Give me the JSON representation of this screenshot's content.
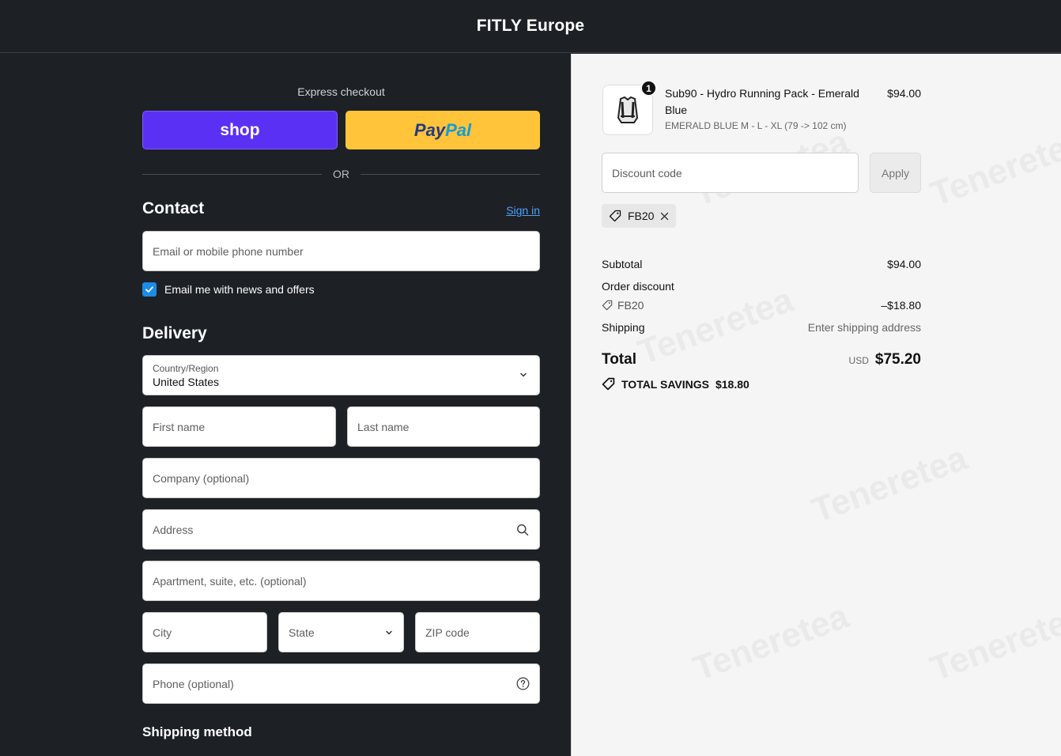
{
  "header": {
    "brand": "FITLY Europe"
  },
  "express": {
    "label": "Express checkout",
    "shop_label": "shop",
    "paypal_pay": "Pay",
    "paypal_pal": "Pal",
    "or_label": "OR"
  },
  "contact": {
    "title": "Contact",
    "sign_in": "Sign in",
    "email_placeholder": "Email or mobile phone number",
    "newsletter_label": "Email me with news and offers",
    "newsletter_checked": true
  },
  "delivery": {
    "title": "Delivery",
    "country_label": "Country/Region",
    "country_value": "United States",
    "first_name_placeholder": "First name",
    "last_name_placeholder": "Last name",
    "company_placeholder": "Company (optional)",
    "address_placeholder": "Address",
    "apartment_placeholder": "Apartment, suite, etc. (optional)",
    "city_placeholder": "City",
    "state_label": "State",
    "zip_placeholder": "ZIP code",
    "phone_placeholder": "Phone (optional)"
  },
  "shipping_method": {
    "title": "Shipping method"
  },
  "order": {
    "item": {
      "quantity": "1",
      "name": "Sub90 - Hydro Running Pack - Emerald Blue",
      "variant": "EMERALD BLUE M - L - XL (79 -> 102 cm)",
      "price": "$94.00"
    },
    "discount_placeholder": "Discount code",
    "apply_label": "Apply",
    "applied_code": "FB20",
    "subtotal_label": "Subtotal",
    "subtotal_value": "$94.00",
    "order_discount_label": "Order discount",
    "order_discount_code": "FB20",
    "order_discount_value": "–$18.80",
    "shipping_label": "Shipping",
    "shipping_value": "Enter shipping address",
    "total_label": "Total",
    "total_currency": "USD",
    "total_value": "$75.20",
    "savings_label": "TOTAL SAVINGS",
    "savings_value": "$18.80"
  },
  "watermark": {
    "text": "Teneretea"
  },
  "colors": {
    "dark_bg": "#1d2025",
    "light_bg": "#f5f5f5",
    "shop_purple": "#5a31f4",
    "paypal_yellow": "#ffc439",
    "link_blue": "#4da3ff",
    "checkbox_blue": "#1d8be8"
  }
}
